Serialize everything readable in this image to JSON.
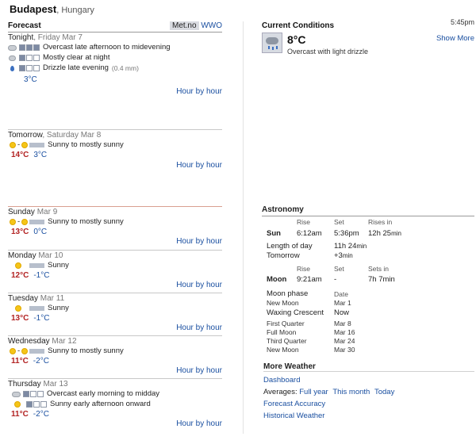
{
  "header": {
    "city": "Budapest",
    "country": ", Hungary"
  },
  "forecast": {
    "title": "Forecast",
    "sources": [
      "Met.no",
      "WWO"
    ],
    "hour_label": "Hour by hour",
    "days": [
      {
        "name": "Tonight",
        "date": ", Friday Mar 7",
        "rows": [
          "Overcast late afternoon to midevening",
          "Mostly clear at night",
          "Drizzle late evening"
        ],
        "mm": "(0.4 mm)",
        "lo": "3°C"
      },
      {
        "name": "Tomorrow",
        "date": ", Saturday Mar 8",
        "text": "Sunny to mostly sunny",
        "hi": "14°C",
        "lo": "3°C"
      },
      {
        "name": "Sunday",
        "date": " Mar 9",
        "text": "Sunny to mostly sunny",
        "hi": "13°C",
        "lo": "0°C"
      },
      {
        "name": "Monday",
        "date": " Mar 10",
        "text": "Sunny",
        "hi": "12°C",
        "lo": "-1°C"
      },
      {
        "name": "Tuesday",
        "date": " Mar 11",
        "text": "Sunny",
        "hi": "13°C",
        "lo": "-1°C"
      },
      {
        "name": "Wednesday",
        "date": " Mar 12",
        "text": "Sunny to mostly sunny",
        "hi": "11°C",
        "lo": "-2°C"
      },
      {
        "name": "Thursday",
        "date": " Mar 13",
        "rows": [
          "Overcast early morning to midday",
          "Sunny early afternoon onward"
        ],
        "hi": "11°C",
        "lo": "-2°C"
      }
    ]
  },
  "current": {
    "title": "Current Conditions",
    "time": "5:45pm",
    "temp": "8°C",
    "desc": "Overcast with light drizzle",
    "more": "Show More"
  },
  "astronomy": {
    "title": "Astronomy",
    "h_rise": "Rise",
    "h_set": "Set",
    "h_rises_in": "Rises in",
    "sun_label": "Sun",
    "sun_rise": "6:12am",
    "sun_set": "5:36pm",
    "sun_in_h": "12h 25",
    "sun_in_m": "min",
    "length_label": "Length of day",
    "length_val": "11h 24",
    "length_unit": "min",
    "tomorrow_label": "Tomorrow",
    "tomorrow_val": "+3",
    "tomorrow_unit": "min",
    "h_sets_in": "Sets in",
    "moon_label": "Moon",
    "moon_rise": "9:21am",
    "moon_set": "-",
    "moon_in": "7h 7min",
    "phase_h": "Moon phase",
    "date_h": "Date",
    "phases": [
      {
        "name": "New Moon",
        "date": "Mar 1"
      },
      {
        "name": "Waxing Crescent",
        "date": "Now"
      },
      {
        "name": "First Quarter",
        "date": "Mar 8"
      },
      {
        "name": "Full Moon",
        "date": "Mar 16"
      },
      {
        "name": "Third Quarter",
        "date": "Mar 24"
      },
      {
        "name": "New Moon",
        "date": "Mar 30"
      }
    ]
  },
  "more_weather": {
    "title": "More Weather",
    "dashboard": "Dashboard",
    "averages_label": "Averages:",
    "full_year": "Full year",
    "this_month": "This month",
    "today": "Today",
    "accuracy": "Forecast Accuracy",
    "historical": "Historical Weather"
  }
}
